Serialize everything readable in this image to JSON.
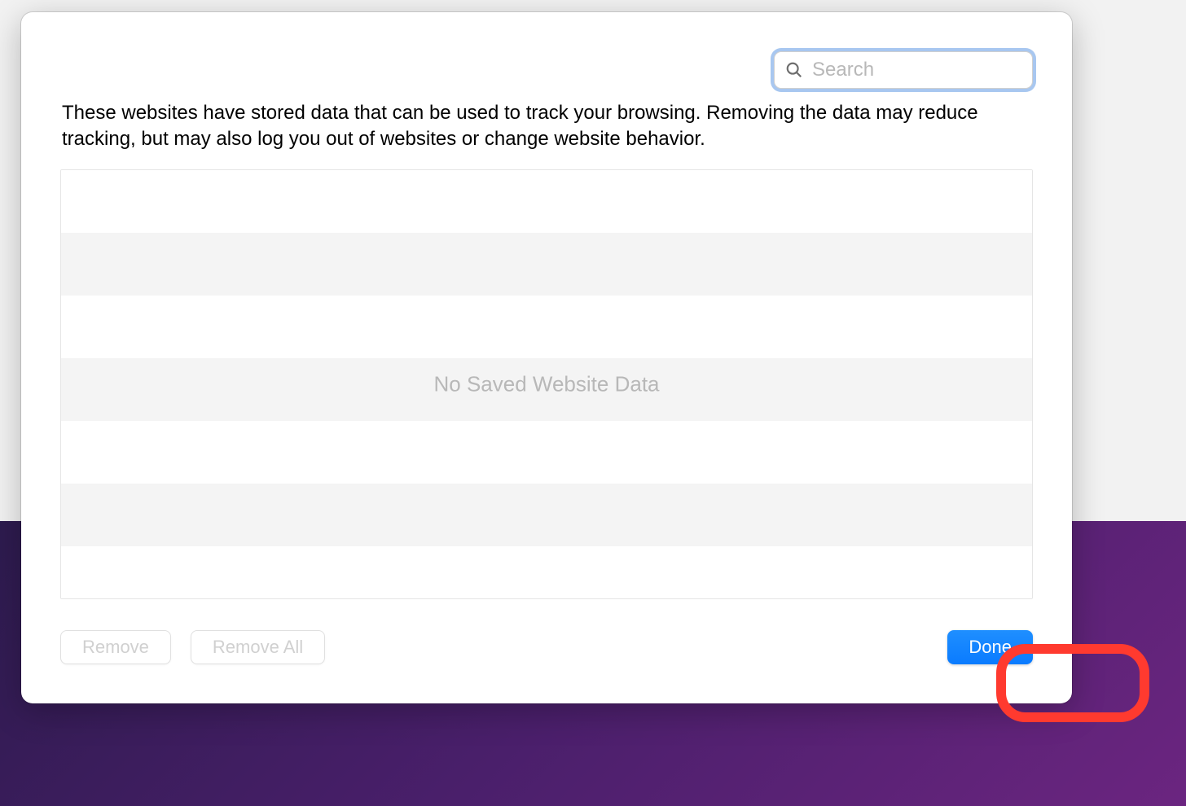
{
  "search": {
    "placeholder": "Search",
    "value": ""
  },
  "description": "These websites have stored data that can be used to track your browsing. Removing the data may reduce tracking, but may also log you out of websites or change website behavior.",
  "list": {
    "empty_message": "No Saved Website Data"
  },
  "buttons": {
    "remove": "Remove",
    "remove_all": "Remove All",
    "done": "Done"
  }
}
